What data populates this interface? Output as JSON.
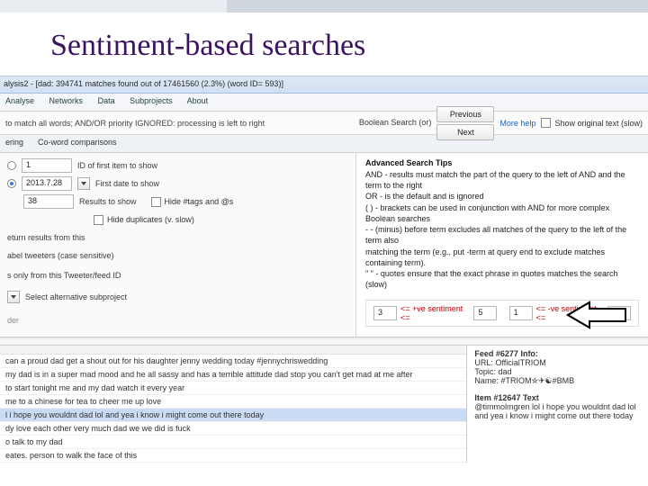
{
  "slide": {
    "title": "Sentiment-based searches"
  },
  "window": {
    "title_fragment": "alysis2 - [dad: 394741 matches found out of 17461560 (2.3%) (word ID= 593)]"
  },
  "menubar": [
    "Analyse",
    "Networks",
    "Data",
    "Subprojects",
    "About"
  ],
  "toolbar": {
    "hint": "to match all words; AND/OR priority IGNORED: processing is left to right",
    "bool_label": "Boolean Search (or)",
    "prev": "Previous",
    "next": "Next",
    "more_help": "More help",
    "show_original": "Show original text (slow)"
  },
  "tabs": [
    "ering",
    "Co-word comparisons"
  ],
  "left": {
    "id_first_value": "1",
    "id_first_label": "ID of first item to show",
    "date_value": "2013.7.28",
    "date_label": "First date to show",
    "results_value": "38",
    "results_label": "Results to show",
    "hide_tags": "Hide #tags and @s",
    "hide_dups": "Hide duplicates (v. slow)",
    "return_from": "eturn results from this",
    "case_sensitive": "abel tweeters (case sensitive)",
    "only_from": "s only from this Tweeter/feed ID",
    "alt_subproject": "Select alternative subproject",
    "tab_footer": "der"
  },
  "tips": {
    "title": "Advanced Search Tips",
    "lines": [
      "AND - results must match the part of the query to the left of AND and the term to the right",
      "OR  - is the default and is ignored",
      "( )  - brackets can be used in conjunction with AND for more complex Boolean searches",
      "-    - (minus) before term excludes all matches of the query to the left of the term also",
      "       matching the term (e.g., put -term at query end to exclude matches containing term).",
      "\" \"  - quotes ensure that the exact phrase in quotes matches the search (slow)"
    ]
  },
  "sentiment": {
    "pos_low": "3",
    "pos_label": "<= +ve sentiment <=",
    "pos_high": "5",
    "neg_low": "1",
    "neg_label": "<= -ve sentiment <=",
    "neg_high": "5"
  },
  "results_rows": [
    "can a proud dad get a shout out for his daughter jenny wedding today #jennychriswedding",
    "my dad is in a super mad mood and he all sassy and has a terrible attitude dad stop you can't get mad at me after",
    "to start tonight me and my dad watch it every year",
    "me to a chinese for tea to cheer me up love",
    "l i hope you wouldnt dad lol and yea i know i might come out there today",
    "dy love each other very much dad we we did is fuck",
    "o talk to my dad",
    "eates. person to walk the face of this"
  ],
  "feed_info": {
    "header": "Feed #6277 Info:",
    "url_k": "URL:",
    "url_v": "OfficialTRIOM",
    "topic_k": "Topic:",
    "topic_v": "dad",
    "name_k": "Name:",
    "name_v": "#TRIOM✮✈☯#BMB",
    "item_header": "Item #12647 Text",
    "item_text": "@timmolmgren lol i hope you wouldnt dad lol and yea i know i might come out there today"
  }
}
